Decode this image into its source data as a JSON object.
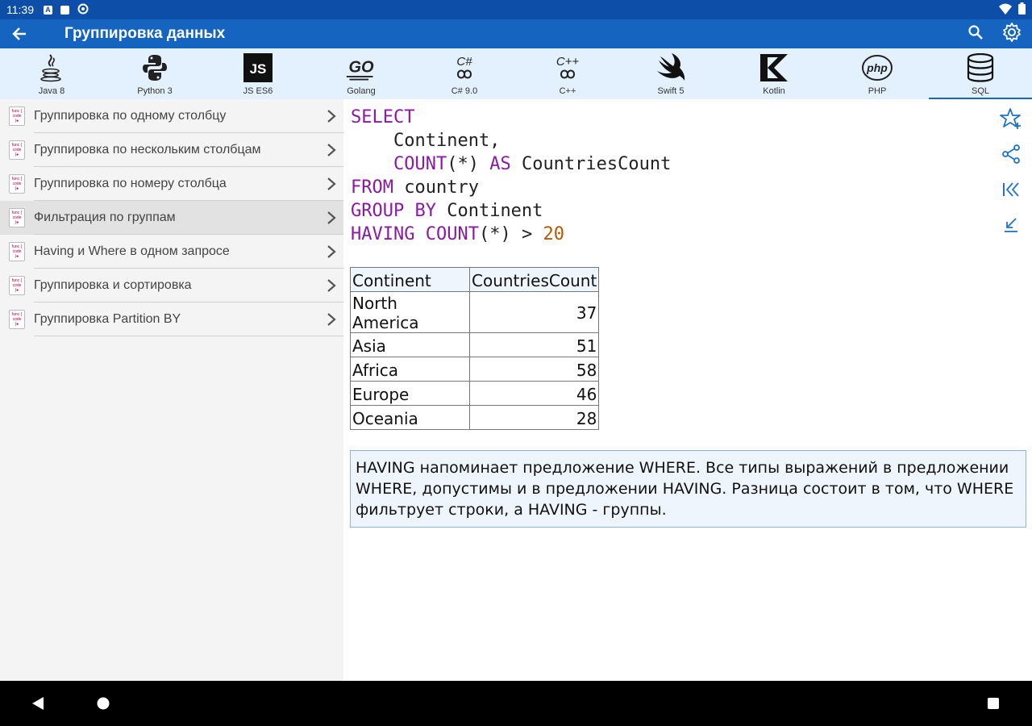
{
  "status": {
    "time": "11:39"
  },
  "appbar": {
    "title": "Группировка данных"
  },
  "languages": [
    {
      "label": "Java 8",
      "icon": "java-icon"
    },
    {
      "label": "Python 3",
      "icon": "python-icon"
    },
    {
      "label": "JS ES6",
      "icon": "js-icon",
      "glyph": "JS"
    },
    {
      "label": "Golang",
      "icon": "go-icon",
      "glyph": "GO"
    },
    {
      "label": "C# 9.0",
      "icon": "csharp-icon",
      "glyph": "C#"
    },
    {
      "label": "C++",
      "icon": "cpp-icon",
      "glyph": "C++"
    },
    {
      "label": "Swift 5",
      "icon": "swift-icon"
    },
    {
      "label": "Kotlin",
      "icon": "kotlin-icon"
    },
    {
      "label": "PHP",
      "icon": "php-icon",
      "glyph": "php"
    },
    {
      "label": "SQL",
      "icon": "database-icon",
      "active": true
    }
  ],
  "sidebar": {
    "items": [
      {
        "label": "Группировка по одному столбцу"
      },
      {
        "label": "Группировка по нескольким столбцам"
      },
      {
        "label": "Группировка по номеру столбца"
      },
      {
        "label": "Фильтрация по группам",
        "selected": true
      },
      {
        "label": "Having и Where в одном запросе"
      },
      {
        "label": "Группировка и сортировка"
      },
      {
        "label": "Группировка Partition BY"
      }
    ],
    "file_icon_text": [
      "func {",
      "code",
      "|●"
    ]
  },
  "code": {
    "lines": [
      [
        {
          "t": "SELECT",
          "k": "kw"
        }
      ],
      [
        {
          "t": "    Continent,"
        }
      ],
      [
        {
          "t": "    "
        },
        {
          "t": "COUNT",
          "k": "kw"
        },
        {
          "t": "(*) "
        },
        {
          "t": "AS",
          "k": "kw"
        },
        {
          "t": " CountriesCount"
        }
      ],
      [
        {
          "t": "FROM",
          "k": "kw"
        },
        {
          "t": " country"
        }
      ],
      [
        {
          "t": "GROUP BY",
          "k": "kw"
        },
        {
          "t": " Continent"
        }
      ],
      [
        {
          "t": "HAVING",
          "k": "kw"
        },
        {
          "t": " "
        },
        {
          "t": "COUNT",
          "k": "kw"
        },
        {
          "t": "(*) > "
        },
        {
          "t": "20",
          "k": "num"
        }
      ]
    ]
  },
  "result": {
    "headers": [
      "Continent",
      "CountriesCount"
    ],
    "rows": [
      [
        "North America",
        "37"
      ],
      [
        "Asia",
        "51"
      ],
      [
        "Africa",
        "58"
      ],
      [
        "Europe",
        "46"
      ],
      [
        "Oceania",
        "28"
      ]
    ]
  },
  "note": "HAVING напоминает предложение WHERE. Все типы выражений в предложении WHERE, допустимы и в предложении HAVING. Разница состоит в том, что WHERE фильтрует строки, а HAVING - группы.",
  "colors": {
    "statusbar": "#0d4fa8",
    "appbar": "#1565c0",
    "langbar": "#e3f0fd",
    "keyword": "#8b1aa3",
    "number": "#b35a00",
    "accent": "#1e74c8"
  }
}
